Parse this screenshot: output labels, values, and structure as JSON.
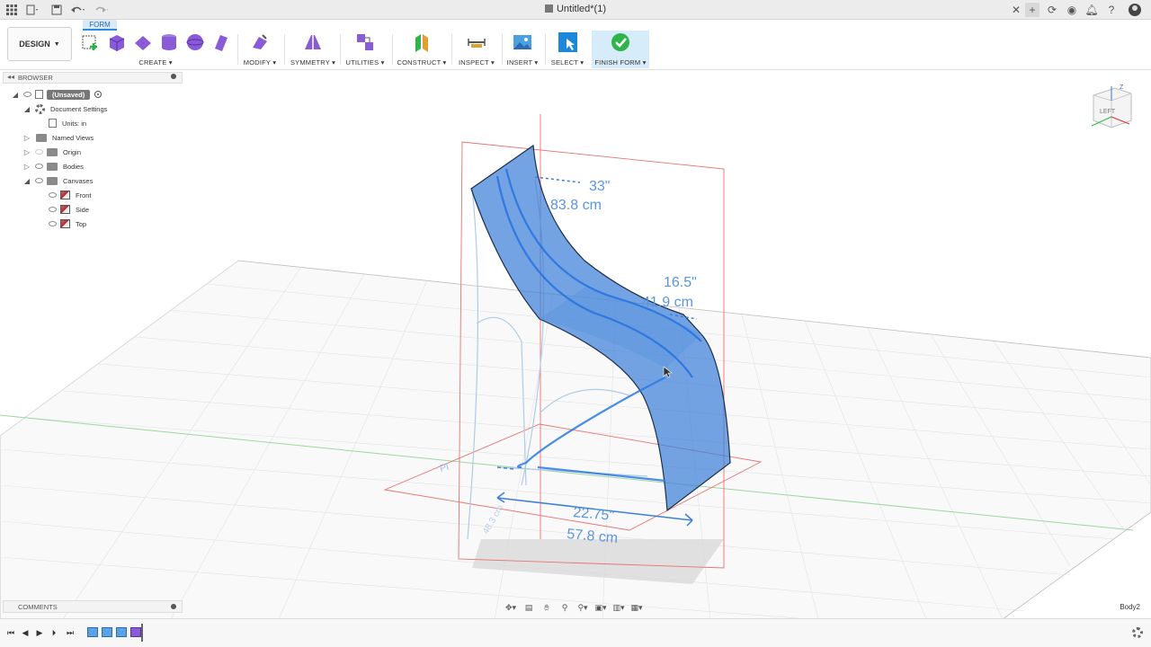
{
  "window": {
    "title": "Untitled*(1)"
  },
  "toolbar": {
    "design_label": "DESIGN",
    "active_tab": "FORM",
    "groups": [
      {
        "label": "CREATE"
      },
      {
        "label": "MODIFY"
      },
      {
        "label": "SYMMETRY"
      },
      {
        "label": "UTILITIES"
      },
      {
        "label": "CONSTRUCT"
      },
      {
        "label": "INSPECT"
      },
      {
        "label": "INSERT"
      },
      {
        "label": "SELECT"
      },
      {
        "label": "FINISH FORM"
      }
    ]
  },
  "browser": {
    "title": "BROWSER",
    "items": [
      {
        "label": "(Unsaved)"
      },
      {
        "label": "Document Settings"
      },
      {
        "label": "Units: in"
      },
      {
        "label": "Named Views"
      },
      {
        "label": "Origin"
      },
      {
        "label": "Bodies"
      },
      {
        "label": "Canvases"
      },
      {
        "label": "Front"
      },
      {
        "label": "Side"
      },
      {
        "label": "Top"
      }
    ]
  },
  "viewport": {
    "dimensions": {
      "height_in": "33\"",
      "height_cm": "83.8 cm",
      "seat_in": "16.5\"",
      "seat_cm": "41.9 cm",
      "depth_in": "22.75\"",
      "depth_cm": "57.8 cm",
      "small_cm": "48.3 cm",
      "plane_label": "Pl"
    },
    "viewcube_label": "LEFT",
    "viewcube_axis": "Z"
  },
  "comments": {
    "title": "COMMENTS"
  },
  "status": {
    "body_label": "Body2"
  },
  "colors": {
    "accent": "#2a8ce0",
    "surface": "#3d7fd8",
    "form_purple": "#8a5bd6",
    "finish_green": "#2fb44a"
  }
}
